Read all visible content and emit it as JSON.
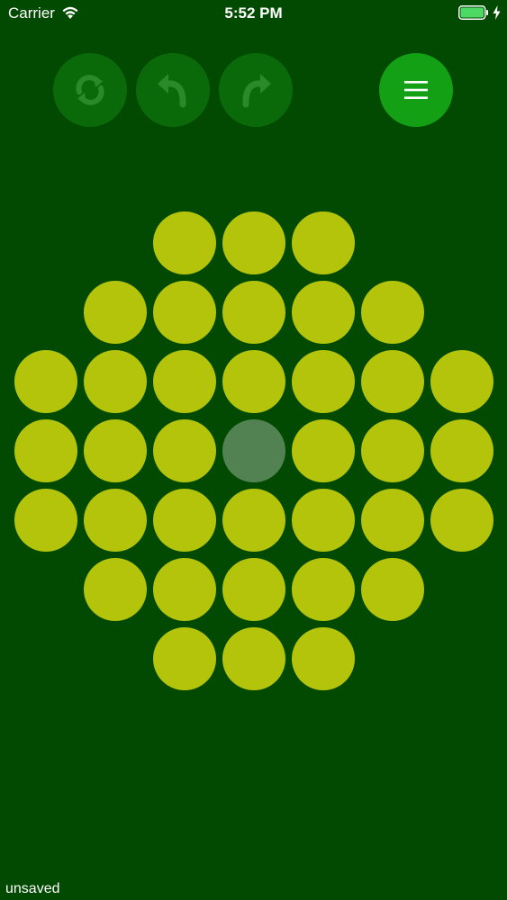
{
  "status_bar": {
    "carrier": "Carrier",
    "time": "5:52 PM",
    "battery_color": "#4cd964"
  },
  "toolbar": {
    "restart_icon": "restart-icon",
    "undo_icon": "undo-icon",
    "redo_icon": "redo-icon",
    "menu_icon": "menu-icon",
    "button_color": "#0a6a0a",
    "menu_button_color": "#14a014"
  },
  "board": {
    "peg_color": "#b3c40a",
    "rows": [
      [
        0,
        0,
        1,
        1,
        1,
        0,
        0
      ],
      [
        0,
        1,
        1,
        1,
        1,
        1,
        0
      ],
      [
        1,
        1,
        1,
        1,
        1,
        1,
        1
      ],
      [
        1,
        1,
        1,
        2,
        1,
        1,
        1
      ],
      [
        1,
        1,
        1,
        1,
        1,
        1,
        1
      ],
      [
        0,
        1,
        1,
        1,
        1,
        1,
        0
      ],
      [
        0,
        0,
        1,
        1,
        1,
        0,
        0
      ]
    ]
  },
  "footer": {
    "save_status": "unsaved"
  }
}
